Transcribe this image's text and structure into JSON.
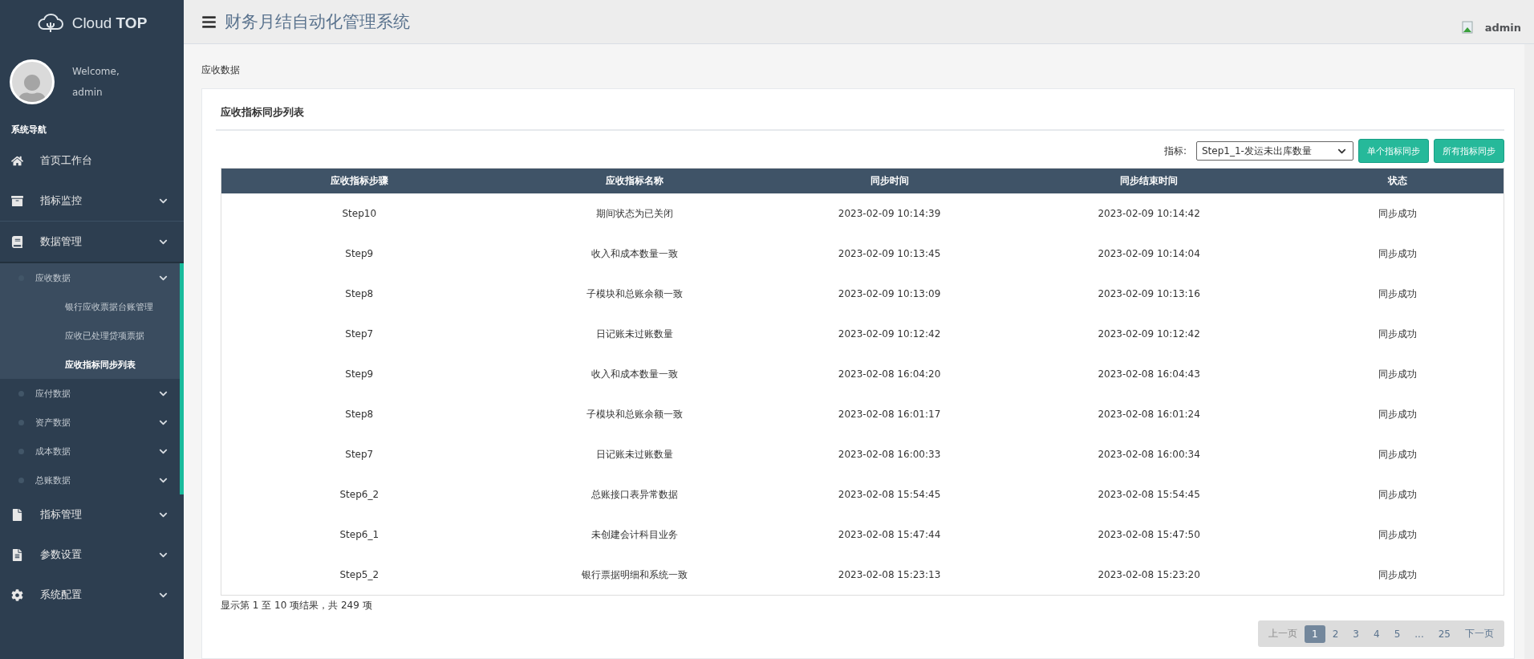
{
  "brand": {
    "name": "Cloud ",
    "bold": "TOP"
  },
  "user": {
    "welcome": "Welcome,",
    "name": "admin"
  },
  "nav_title": "系统导航",
  "nav": [
    {
      "label": "首页工作台",
      "kind": "link",
      "selected": false
    },
    {
      "label": "指标监控",
      "kind": "group",
      "selected": false
    },
    {
      "label": "数据管理",
      "kind": "group",
      "expanded": true,
      "selected": true,
      "children": [
        {
          "label": "应收数据",
          "expanded": true,
          "children": [
            {
              "label": "银行应收票据台账管理",
              "selected": false
            },
            {
              "label": "应收已处理贷项票据",
              "selected": false
            },
            {
              "label": "应收指标同步列表",
              "selected": true
            }
          ]
        },
        {
          "label": "应付数据"
        },
        {
          "label": "资产数据"
        },
        {
          "label": "成本数据"
        },
        {
          "label": "总账数据"
        }
      ]
    },
    {
      "label": "指标管理",
      "kind": "group",
      "selected": false
    },
    {
      "label": "参数设置",
      "kind": "group",
      "selected": false
    },
    {
      "label": "系统配置",
      "kind": "group",
      "selected": false
    }
  ],
  "header": {
    "title": "财务月结自动化管理系统",
    "user": "admin"
  },
  "breadcrumb": "应收数据",
  "card_title": "应收指标同步列表",
  "filter": {
    "label": "指标:",
    "value": "Step1_1-发运未出库数量"
  },
  "buttons": [
    "单个指标同步",
    "所有指标同步"
  ],
  "table": {
    "columns": [
      "应收指标步骤",
      "应收指标名称",
      "同步时间",
      "同步结束时间",
      "状态"
    ],
    "rows": [
      [
        "Step10",
        "期间状态为已关闭",
        "2023-02-09 10:14:39",
        "2023-02-09 10:14:42",
        "同步成功"
      ],
      [
        "Step9",
        "收入和成本数量一致",
        "2023-02-09 10:13:45",
        "2023-02-09 10:14:04",
        "同步成功"
      ],
      [
        "Step8",
        "子模块和总账余额一致",
        "2023-02-09 10:13:09",
        "2023-02-09 10:13:16",
        "同步成功"
      ],
      [
        "Step7",
        "日记账未过账数量",
        "2023-02-09 10:12:42",
        "2023-02-09 10:12:42",
        "同步成功"
      ],
      [
        "Step9",
        "收入和成本数量一致",
        "2023-02-08 16:04:20",
        "2023-02-08 16:04:43",
        "同步成功"
      ],
      [
        "Step8",
        "子模块和总账余额一致",
        "2023-02-08 16:01:17",
        "2023-02-08 16:01:24",
        "同步成功"
      ],
      [
        "Step7",
        "日记账未过账数量",
        "2023-02-08 16:00:33",
        "2023-02-08 16:00:34",
        "同步成功"
      ],
      [
        "Step6_2",
        "总账接口表异常数据",
        "2023-02-08 15:54:45",
        "2023-02-08 15:54:45",
        "同步成功"
      ],
      [
        "Step6_1",
        "未创建会计科目业务",
        "2023-02-08 15:47:44",
        "2023-02-08 15:47:50",
        "同步成功"
      ],
      [
        "Step5_2",
        "银行票据明细和系统一致",
        "2023-02-08 15:23:13",
        "2023-02-08 15:23:20",
        "同步成功"
      ]
    ]
  },
  "summary": "显示第 1 至 10 项结果，共 249 项",
  "pagination": {
    "prev": {
      "label": "上一页",
      "disabled": true
    },
    "pages": [
      {
        "label": "1",
        "selected": true
      },
      {
        "label": "2",
        "selected": false
      },
      {
        "label": "3",
        "selected": false
      },
      {
        "label": "4",
        "selected": false
      },
      {
        "label": "5",
        "selected": false
      },
      {
        "label": "...",
        "selected": false
      },
      {
        "label": "25",
        "selected": false
      }
    ],
    "next": {
      "label": "下一页",
      "disabled": false
    }
  }
}
